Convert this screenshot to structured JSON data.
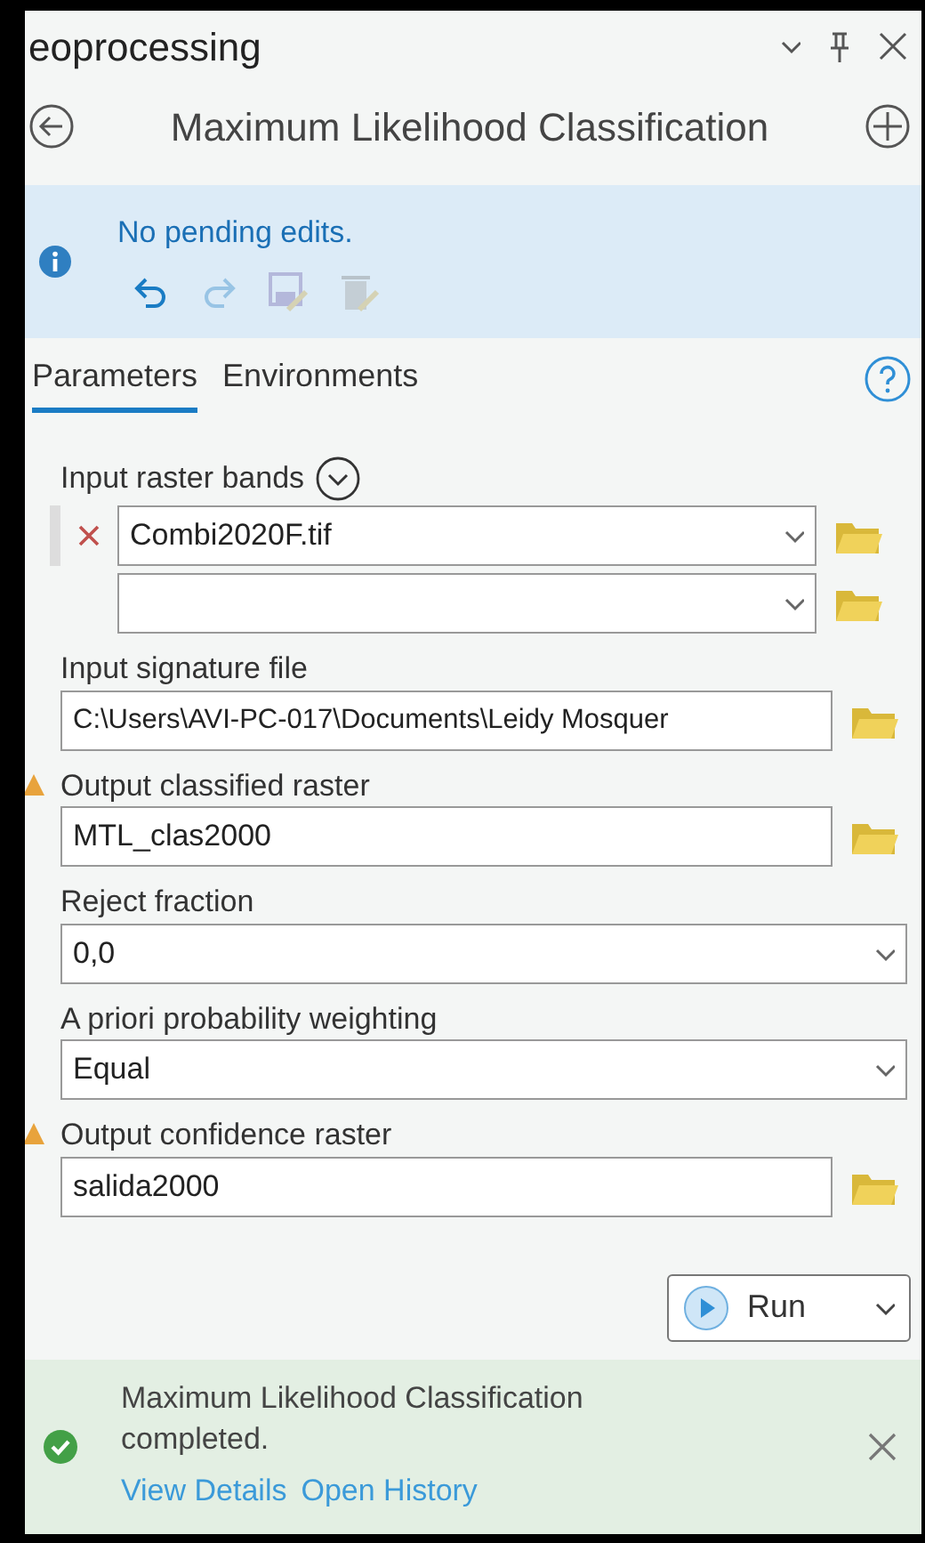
{
  "pane": {
    "title": "eoprocessing"
  },
  "tool": {
    "title": "Maximum Likelihood Classification"
  },
  "edit_bar": {
    "message": "No pending edits.",
    "undo_disabled": false,
    "redo_disabled": true,
    "save_disabled": true,
    "discard_disabled": true
  },
  "tabs": [
    {
      "label": "Parameters",
      "selected": true
    },
    {
      "label": "Environments",
      "selected": false
    }
  ],
  "parameters": [
    {
      "kind": "multivalue",
      "label": "Input raster bands",
      "warning": false,
      "rows": [
        {
          "value": "Combi2020F.tif",
          "removable": true
        },
        {
          "removable": false
        }
      ]
    },
    {
      "kind": "browse",
      "label": "Input signature file",
      "warning": false,
      "value": "C:\\Users\\AVI-PC-017\\Documents\\Leidy Mosquer"
    },
    {
      "kind": "browse",
      "label": "Output classified raster",
      "warning": true,
      "value": "MTL_clas2000"
    },
    {
      "kind": "dropdown",
      "label": "Reject fraction",
      "warning": false,
      "value": "0,0"
    },
    {
      "kind": "dropdown",
      "label": "A priori probability weighting",
      "warning": false,
      "value": "Equal"
    },
    {
      "kind": "browse",
      "label": "Output confidence raster",
      "warning": true,
      "value": "salida2000"
    }
  ],
  "run_button": {
    "label": "Run"
  },
  "status": {
    "kind": "success",
    "message": "Maximum Likelihood Classification completed.",
    "links": [
      "View Details",
      "Open History"
    ]
  }
}
